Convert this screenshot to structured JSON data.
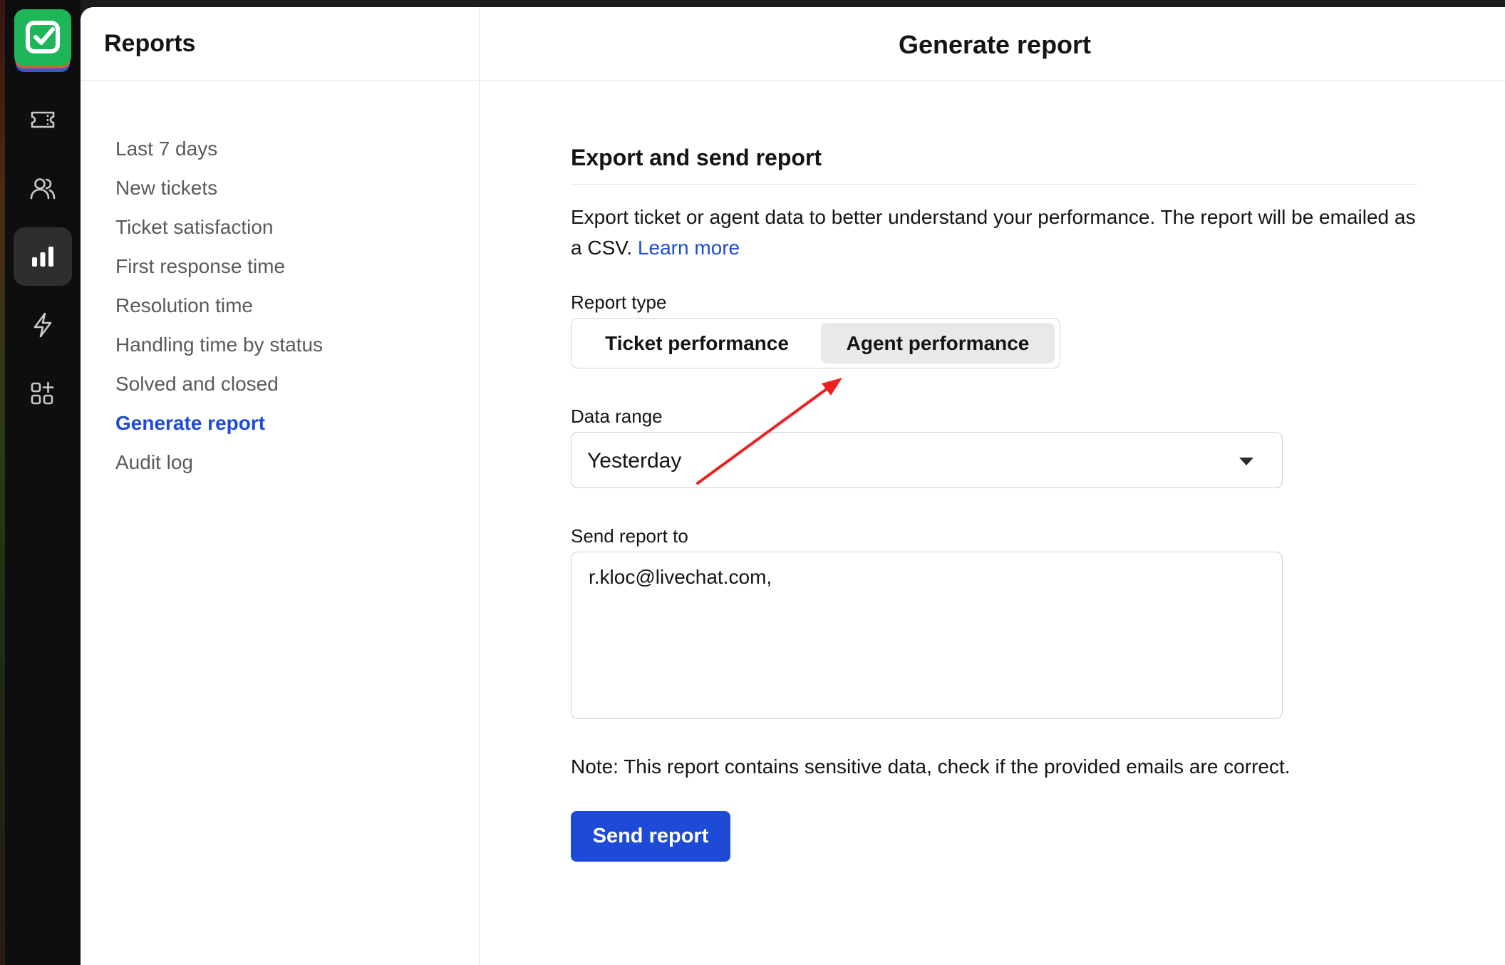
{
  "rail": {
    "items": [
      {
        "icon": "ticket-icon",
        "active": false
      },
      {
        "icon": "users-icon",
        "active": false
      },
      {
        "icon": "bar-chart-icon",
        "active": true
      },
      {
        "icon": "lightning-icon",
        "active": false
      },
      {
        "icon": "apps-icon",
        "active": false
      }
    ]
  },
  "sidebar": {
    "title": "Reports",
    "items": [
      {
        "label": "Last 7 days",
        "active": false
      },
      {
        "label": "New tickets",
        "active": false
      },
      {
        "label": "Ticket satisfaction",
        "active": false
      },
      {
        "label": "First response time",
        "active": false
      },
      {
        "label": "Resolution time",
        "active": false
      },
      {
        "label": "Handling time by status",
        "active": false
      },
      {
        "label": "Solved and closed",
        "active": false
      },
      {
        "label": "Generate report",
        "active": true
      },
      {
        "label": "Audit log",
        "active": false
      }
    ]
  },
  "main": {
    "title": "Generate report",
    "section_title": "Export and send report",
    "description": "Export ticket or agent data to better understand your performance. The report will be emailed as a CSV.",
    "learn_more": "Learn more",
    "report_type": {
      "label": "Report type",
      "options": [
        "Ticket performance",
        "Agent performance"
      ],
      "selected": "Agent performance"
    },
    "data_range": {
      "label": "Data range",
      "value": "Yesterday"
    },
    "send_to": {
      "label": "Send report to",
      "value": "r.kloc@livechat.com,"
    },
    "note": "Note: This report contains sensitive data, check if the provided emails are correct.",
    "send_button": "Send report"
  },
  "colors": {
    "accent": "#1d4bd8",
    "logo_green": "#1fb65a",
    "annotation_arrow": "#ec2222"
  }
}
